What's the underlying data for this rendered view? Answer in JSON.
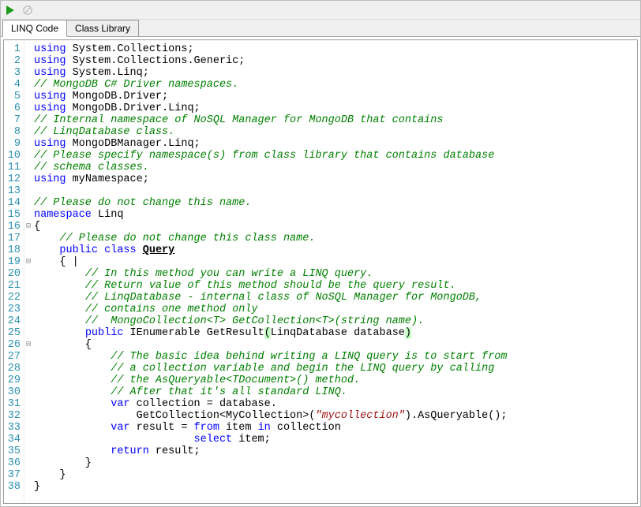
{
  "toolbar": {
    "run_icon": "run-icon",
    "stop_icon": "stop-icon"
  },
  "tabs": {
    "active": "LINQ Code",
    "inactive": "Class Library"
  },
  "code": {
    "lines": [
      {
        "n": 1,
        "fold": "",
        "html": "<span class='kw'>using</span> System.Collections;"
      },
      {
        "n": 2,
        "fold": "",
        "html": "<span class='kw'>using</span> System.Collections.Generic;"
      },
      {
        "n": 3,
        "fold": "",
        "html": "<span class='kw'>using</span> System.Linq;"
      },
      {
        "n": 4,
        "fold": "",
        "html": "<span class='cm'>// MongoDB C# Driver namespaces.</span>"
      },
      {
        "n": 5,
        "fold": "",
        "html": "<span class='kw'>using</span> MongoDB.Driver;"
      },
      {
        "n": 6,
        "fold": "",
        "html": "<span class='kw'>using</span> MongoDB.Driver.Linq;"
      },
      {
        "n": 7,
        "fold": "",
        "html": "<span class='cm'>// Internal namespace of NoSQL Manager for MongoDB that contains</span>"
      },
      {
        "n": 8,
        "fold": "",
        "html": "<span class='cm'>// LinqDatabase class.</span>"
      },
      {
        "n": 9,
        "fold": "",
        "html": "<span class='kw'>using</span> MongoDBManager.Linq;"
      },
      {
        "n": 10,
        "fold": "",
        "html": "<span class='cm'>// Please specify namespace(s) from class library that contains database</span>"
      },
      {
        "n": 11,
        "fold": "",
        "html": "<span class='cm'>// schema classes.</span>"
      },
      {
        "n": 12,
        "fold": "",
        "html": "<span class='kw'>using</span> myNamespace;"
      },
      {
        "n": 13,
        "fold": "",
        "html": ""
      },
      {
        "n": 14,
        "fold": "",
        "html": "<span class='cm'>// Please do not change this name.</span>"
      },
      {
        "n": 15,
        "fold": "",
        "html": "<span class='kw'>namespace</span> Linq"
      },
      {
        "n": 16,
        "fold": "⊟",
        "html": "{"
      },
      {
        "n": 17,
        "fold": "",
        "html": "    <span class='cm'>// Please do not change this class name.</span>"
      },
      {
        "n": 18,
        "fold": "",
        "html": "    <span class='kw'>public</span> <span class='kw'>class</span> <span class='under'>Query</span>"
      },
      {
        "n": 19,
        "fold": "⊟",
        "html": "    { |"
      },
      {
        "n": 20,
        "fold": "",
        "html": "        <span class='cm'>// In this method you can write a LINQ query.</span>"
      },
      {
        "n": 21,
        "fold": "",
        "html": "        <span class='cm'>// Return value of this method should be the query result.</span>"
      },
      {
        "n": 22,
        "fold": "",
        "html": "        <span class='cm'>// LinqDatabase - internal class of NoSQL Manager for MongoDB,</span>"
      },
      {
        "n": 23,
        "fold": "",
        "html": "        <span class='cm'>// contains one method only</span>"
      },
      {
        "n": 24,
        "fold": "",
        "html": "        <span class='cm'>//  MongoCollection&lt;T&gt; GetCollection&lt;T&gt;(string name).</span>"
      },
      {
        "n": 25,
        "fold": "",
        "html": "        <span class='kw'>public</span> IEnumerable GetResult<span class='hl-paren'>(</span>LinqDatabase database<span class='hl-paren'>)</span>"
      },
      {
        "n": 26,
        "fold": "⊟",
        "html": "        {"
      },
      {
        "n": 27,
        "fold": "",
        "html": "            <span class='cm'>// The basic idea behind writing a LINQ query is to start from</span>"
      },
      {
        "n": 28,
        "fold": "",
        "html": "            <span class='cm'>// a collection variable and begin the LINQ query by calling</span>"
      },
      {
        "n": 29,
        "fold": "",
        "html": "            <span class='cm'>// the AsQueryable&lt;TDocument&gt;() method.</span>"
      },
      {
        "n": 30,
        "fold": "",
        "html": "            <span class='cm'>// After that it's all standard LINQ.</span>"
      },
      {
        "n": 31,
        "fold": "",
        "html": "            <span class='kw'>var</span> collection = database."
      },
      {
        "n": 32,
        "fold": "",
        "html": "                GetCollection&lt;MyCollection&gt;(<span class='str'>\"mycollection\"</span>).AsQueryable();"
      },
      {
        "n": 33,
        "fold": "",
        "html": "            <span class='kw'>var</span> result = <span class='kw'>from</span> item <span class='kw'>in</span> collection"
      },
      {
        "n": 34,
        "fold": "",
        "html": "                         <span class='kw'>select</span> item;"
      },
      {
        "n": 35,
        "fold": "",
        "html": "            <span class='kw'>return</span> result;"
      },
      {
        "n": 36,
        "fold": "",
        "html": "        }"
      },
      {
        "n": 37,
        "fold": "",
        "html": "    }"
      },
      {
        "n": 38,
        "fold": "",
        "html": "}"
      }
    ]
  }
}
